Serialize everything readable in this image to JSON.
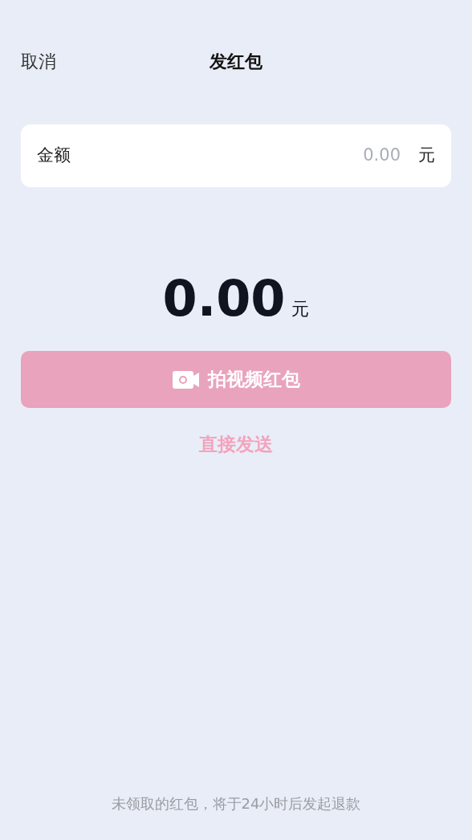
{
  "header": {
    "cancel": "取消",
    "title": "发红包"
  },
  "amount_field": {
    "label": "金额",
    "placeholder": "0.00",
    "unit": "元"
  },
  "total": {
    "value": "0.00",
    "unit": "元"
  },
  "video_button": {
    "label": "拍视频红包",
    "disabled": true
  },
  "direct_send": {
    "label": "直接发送",
    "disabled": true
  },
  "footer_note": "未领取的红包，将于24小时后发起退款"
}
